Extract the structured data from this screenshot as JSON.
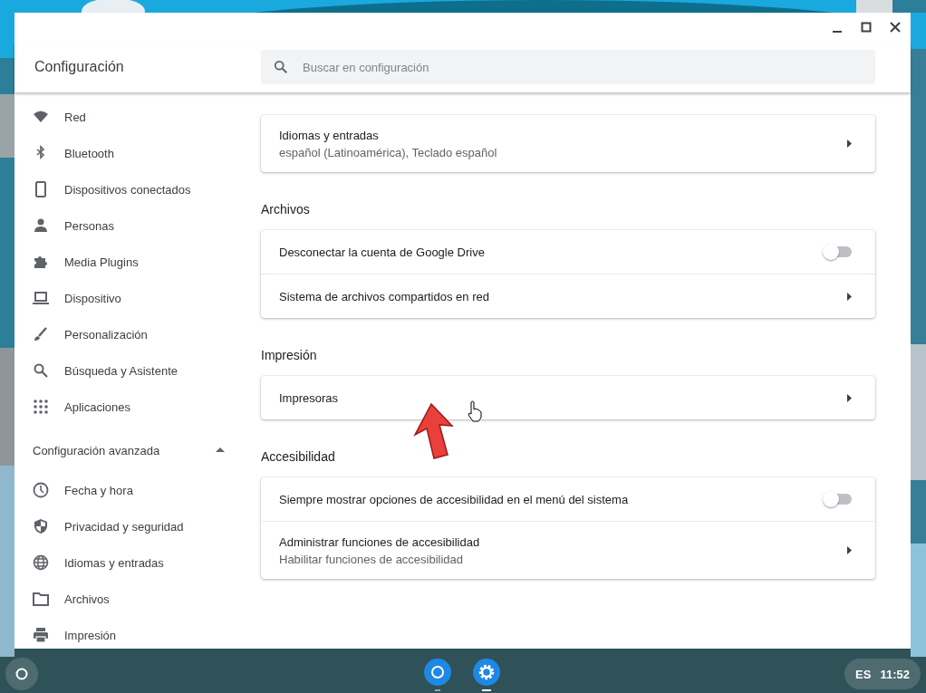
{
  "window": {
    "title": "Configuración",
    "search": {
      "placeholder": "Buscar en configuración"
    }
  },
  "sidebar": {
    "items": [
      {
        "label": "Red"
      },
      {
        "label": "Bluetooth"
      },
      {
        "label": "Dispositivos conectados"
      },
      {
        "label": "Personas"
      },
      {
        "label": "Media Plugins"
      },
      {
        "label": "Dispositivo"
      },
      {
        "label": "Personalización"
      },
      {
        "label": "Búsqueda y Asistente"
      },
      {
        "label": "Aplicaciones"
      }
    ],
    "advanced": {
      "label": "Configuración avanzada",
      "expanded": true,
      "items": [
        {
          "label": "Fecha y hora"
        },
        {
          "label": "Privacidad y seguridad"
        },
        {
          "label": "Idiomas y entradas"
        },
        {
          "label": "Archivos"
        },
        {
          "label": "Impresión"
        }
      ]
    }
  },
  "sections": [
    {
      "rows": [
        {
          "kind": "link",
          "label": "Idiomas y entradas",
          "sublabel": "español (Latinoamérica), Teclado español"
        }
      ]
    },
    {
      "title": "Archivos",
      "rows": [
        {
          "kind": "toggle",
          "label": "Desconectar la cuenta de Google Drive",
          "on": false
        },
        {
          "kind": "link",
          "label": "Sistema de archivos compartidos en red"
        }
      ]
    },
    {
      "title": "Impresión",
      "rows": [
        {
          "kind": "link",
          "label": "Impresoras"
        }
      ]
    },
    {
      "title": "Accesibilidad",
      "rows": [
        {
          "kind": "toggle",
          "label": "Siempre mostrar opciones de accesibilidad en el menú del sistema",
          "on": false
        },
        {
          "kind": "link",
          "label": "Administrar funciones de accesibilidad",
          "sublabel": "Habilitar funciones de accesibilidad"
        }
      ]
    }
  ],
  "taskbar": {
    "language": "ES",
    "time": "11:52"
  }
}
